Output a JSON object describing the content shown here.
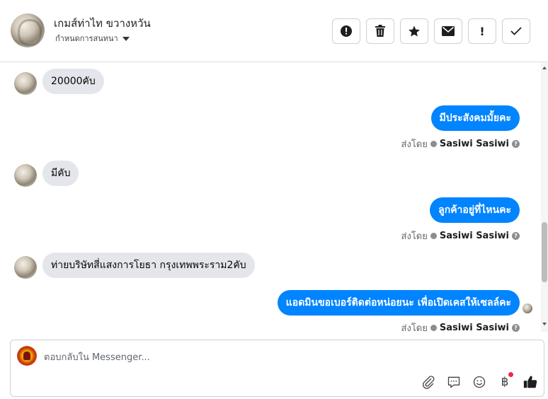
{
  "header": {
    "contact_name": "เกมส์ท่าไท ขวางหวัน",
    "manage_label": "กำหนดการสนทนา",
    "actions": [
      {
        "icon": "alert-circle-icon",
        "name": "mark-spam-button"
      },
      {
        "icon": "trash-icon",
        "name": "delete-button"
      },
      {
        "icon": "star-icon",
        "name": "star-button"
      },
      {
        "icon": "envelope-icon",
        "name": "mark-unread-button"
      },
      {
        "icon": "exclamation-icon",
        "name": "follow-up-button",
        "label": "!"
      },
      {
        "icon": "check-icon",
        "name": "mark-done-button"
      }
    ]
  },
  "messages": [
    {
      "direction": "in",
      "text": "20000คับ"
    },
    {
      "direction": "out",
      "text": "มีประสังคมมั้ยคะ",
      "sent_by_label": "ส่งโดย",
      "sender": "Sasiwi Sasiwi"
    },
    {
      "direction": "in",
      "text": "มีคับ"
    },
    {
      "direction": "out",
      "text": "ลูกค้าอยู่ที่ไหนคะ",
      "sent_by_label": "ส่งโดย",
      "sender": "Sasiwi Sasiwi"
    },
    {
      "direction": "in",
      "text": "ท่ายบริษัทสี่แสงการโยธา กรุงเทพพระราม2คับ"
    },
    {
      "direction": "out",
      "text": "แอดมินขอเบอร์ติดต่อหน่อยนะ เพื่อเปิดเคสให้เซลล์คะ",
      "sent_by_label": "ส่งโดย",
      "sender": "Sasiwi Sasiwi"
    }
  ],
  "help_glyph": "?",
  "composer": {
    "placeholder": "ตอบกลับใน Messenger...",
    "tools": [
      "paperclip-icon",
      "saved-replies-icon",
      "emoji-icon",
      "payment-baht-icon",
      "like-icon"
    ],
    "baht_glyph": "฿"
  },
  "colors": {
    "outgoing_bubble": "#0084ff",
    "incoming_bubble": "#e4e6eb",
    "notification_dot": "#f02849"
  }
}
